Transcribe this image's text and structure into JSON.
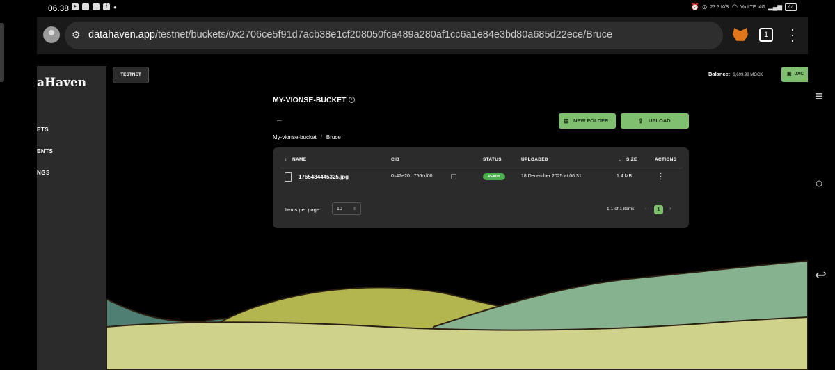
{
  "status_bar": {
    "time": "06.38",
    "network": "4G",
    "speed": "23.3 K/S",
    "volte": "Vo LTE",
    "battery": "44"
  },
  "browser": {
    "url_host": "datahaven.app",
    "url_path": "/testnet/buckets/0x2706ce5f91d7acb38e1cf208050fca489a280af1cc6a1e84e3bd80a685d22ece/Bruce",
    "tab_count": "1"
  },
  "sidebar": {
    "logo": "aHaven",
    "items": [
      {
        "label": "ETS"
      },
      {
        "label": "ENTS"
      },
      {
        "label": "NGS"
      }
    ]
  },
  "header": {
    "network_badge": "TESTNET",
    "balance_label": "Balance:",
    "balance_value": "6,699.98 MOCK",
    "wallet_label": "0XC"
  },
  "bucket": {
    "title": "MY-VIONSE-BUCKET",
    "new_folder_label": "NEW FOLDER",
    "upload_label": "UPLOAD",
    "breadcrumb": [
      "My-vionse-bucket",
      "Bruce"
    ]
  },
  "table": {
    "columns": [
      "NAME",
      "CID",
      "STATUS",
      "UPLOADED",
      "SIZE",
      "ACTIONS"
    ],
    "rows": [
      {
        "name": "1765484445325.jpg",
        "cid": "0x42e20...756cd00",
        "status": "READY",
        "uploaded": "18 December 2025 at 06:31",
        "size": "1.4 MB"
      }
    ],
    "items_per_page_label": "Items per page:",
    "items_per_page_value": "10",
    "pagination_text": "1-1 of 1 items",
    "current_page": "1"
  },
  "colors": {
    "accent_green": "#7fbf6f",
    "status_ready": "#4caf50",
    "panel": "#2b2b2b"
  }
}
